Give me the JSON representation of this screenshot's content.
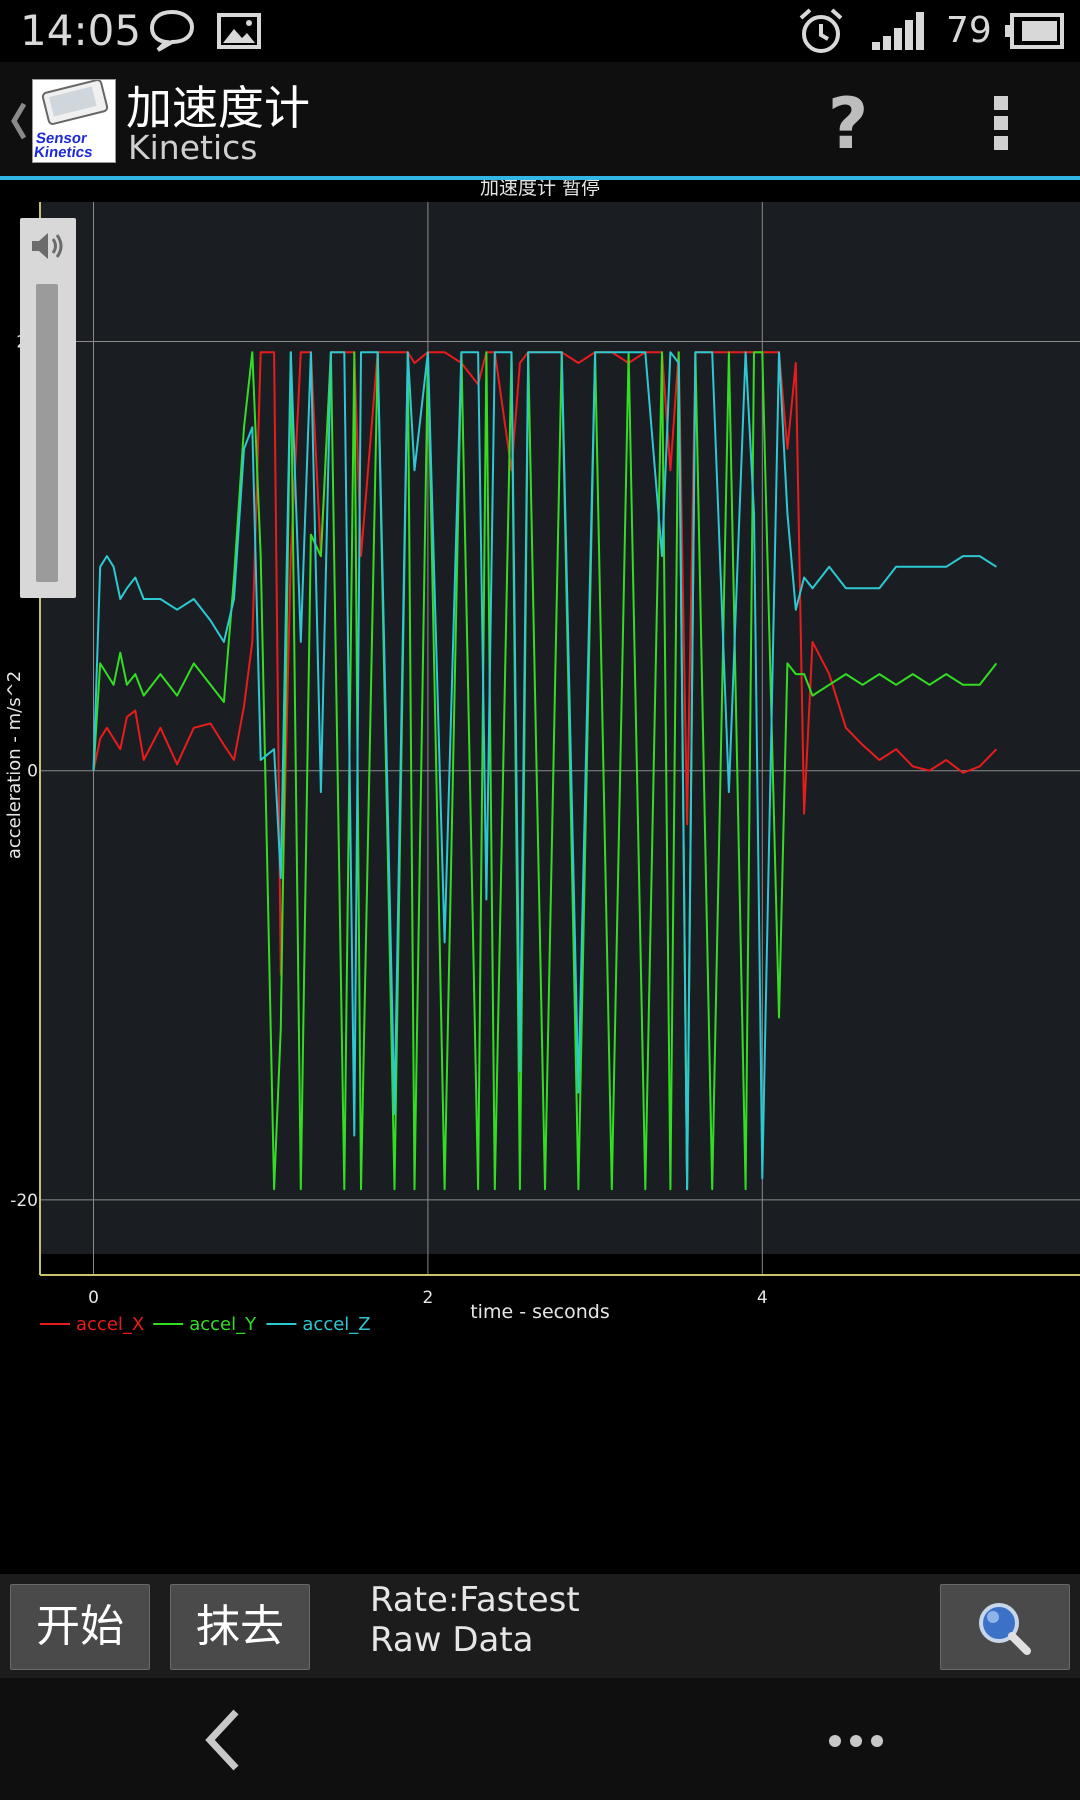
{
  "status_bar": {
    "time": "14:05",
    "battery_level": "79",
    "icons": [
      "chat-icon",
      "image-icon",
      "alarm-icon",
      "signal-icon",
      "battery-icon"
    ]
  },
  "action_bar": {
    "title": "加速度计",
    "subtitle": "Kinetics",
    "app_icon_text": "Sensor Kinetics",
    "help_label": "?",
    "accent_color": "#33b5e5"
  },
  "chart_data": {
    "type": "line",
    "title": "加速度计 暂停",
    "xlabel": "time - seconds",
    "ylabel": "acceleration - m/s^2",
    "xlim": [
      -0.32,
      5.9
    ],
    "ylim": [
      -23.5,
      26.5
    ],
    "x_ticks": [
      0,
      2,
      4
    ],
    "y_ticks": [
      -20,
      0,
      20
    ],
    "grid": true,
    "legend_position": "bottom-left",
    "series": [
      {
        "name": "accel_X",
        "color": "#e81c1c",
        "x": [
          0,
          0.04,
          0.08,
          0.12,
          0.16,
          0.2,
          0.25,
          0.3,
          0.4,
          0.5,
          0.6,
          0.7,
          0.78,
          0.84,
          0.9,
          0.95,
          1.0,
          1.08,
          1.12,
          1.18,
          1.24,
          1.3,
          1.36,
          1.42,
          1.5,
          1.56,
          1.6,
          1.7,
          1.8,
          1.88,
          1.92,
          2.0,
          2.1,
          2.2,
          2.3,
          2.35,
          2.4,
          2.5,
          2.55,
          2.6,
          2.7,
          2.8,
          2.9,
          3.0,
          3.1,
          3.2,
          3.3,
          3.4,
          3.45,
          3.5,
          3.55,
          3.6,
          3.7,
          3.8,
          3.9,
          3.95,
          4.0,
          4.1,
          4.15,
          4.2,
          4.25,
          4.3,
          4.4,
          4.5,
          4.6,
          4.7,
          4.8,
          4.9,
          5.0,
          5.1,
          5.2,
          5.3,
          5.4
        ],
        "y": [
          0,
          1.5,
          2,
          1.5,
          1,
          2.5,
          2.8,
          0.5,
          2,
          0.3,
          2,
          2.2,
          1.2,
          0.5,
          3,
          6,
          19.5,
          19.5,
          -9.5,
          10,
          19.5,
          19.5,
          10,
          19.5,
          19.5,
          19.5,
          10,
          19.5,
          19.5,
          19.5,
          19,
          19.5,
          19.5,
          19,
          18,
          19.5,
          19.5,
          14,
          19,
          19.5,
          19.5,
          19.5,
          19,
          19.5,
          19.5,
          19,
          19.5,
          19.5,
          14,
          19.5,
          -2.5,
          19.5,
          19.5,
          19.5,
          19.5,
          19.5,
          19.5,
          19.5,
          15,
          19,
          -2,
          6,
          4.5,
          2,
          1.2,
          0.5,
          1,
          0.2,
          0,
          0.5,
          -0.1,
          0.2,
          1
        ]
      },
      {
        "name": "accel_Y",
        "color": "#33dd22",
        "x": [
          0,
          0.04,
          0.08,
          0.12,
          0.16,
          0.2,
          0.25,
          0.3,
          0.4,
          0.5,
          0.6,
          0.7,
          0.78,
          0.84,
          0.9,
          0.95,
          1.0,
          1.08,
          1.12,
          1.18,
          1.24,
          1.3,
          1.36,
          1.42,
          1.5,
          1.56,
          1.6,
          1.7,
          1.8,
          1.88,
          1.92,
          2.0,
          2.1,
          2.2,
          2.3,
          2.35,
          2.4,
          2.5,
          2.55,
          2.6,
          2.7,
          2.8,
          2.9,
          3.0,
          3.1,
          3.2,
          3.3,
          3.4,
          3.45,
          3.5,
          3.55,
          3.6,
          3.7,
          3.8,
          3.9,
          3.95,
          4.0,
          4.1,
          4.15,
          4.2,
          4.25,
          4.3,
          4.4,
          4.5,
          4.6,
          4.7,
          4.8,
          4.9,
          5.0,
          5.1,
          5.2,
          5.3,
          5.4
        ],
        "y": [
          0,
          5,
          4.5,
          4,
          5.5,
          4,
          4.5,
          3.5,
          4.5,
          3.5,
          5,
          4,
          3.2,
          9,
          16,
          19.5,
          10,
          -19.5,
          -12,
          19.5,
          -19.5,
          11,
          10,
          19.5,
          -19.5,
          19.5,
          -19.5,
          19.5,
          -19.5,
          19.5,
          -19.5,
          19.5,
          -19.5,
          19.5,
          -19.5,
          19.5,
          -19.5,
          19.5,
          -19.5,
          19.5,
          -19.5,
          19.5,
          -19.5,
          19.5,
          -19.5,
          19.5,
          -19.5,
          19.5,
          -19.5,
          19.5,
          -19.5,
          19.5,
          -19.5,
          19.5,
          -19.5,
          19.5,
          19.5,
          -11.5,
          5,
          4.5,
          4.5,
          3.5,
          4,
          4.5,
          4,
          4.5,
          4,
          4.5,
          4,
          4.5,
          4,
          4,
          5
        ]
      },
      {
        "name": "accel_Z",
        "color": "#2dc8d2",
        "x": [
          0,
          0.04,
          0.08,
          0.12,
          0.16,
          0.2,
          0.25,
          0.3,
          0.4,
          0.5,
          0.6,
          0.7,
          0.78,
          0.84,
          0.9,
          0.95,
          1.0,
          1.08,
          1.12,
          1.18,
          1.24,
          1.3,
          1.36,
          1.42,
          1.5,
          1.56,
          1.6,
          1.7,
          1.8,
          1.88,
          1.92,
          2.0,
          2.1,
          2.2,
          2.3,
          2.35,
          2.4,
          2.5,
          2.55,
          2.6,
          2.7,
          2.8,
          2.9,
          3.0,
          3.1,
          3.2,
          3.3,
          3.4,
          3.45,
          3.5,
          3.55,
          3.6,
          3.7,
          3.8,
          3.9,
          3.95,
          4.0,
          4.1,
          4.15,
          4.2,
          4.25,
          4.3,
          4.4,
          4.5,
          4.6,
          4.7,
          4.8,
          4.9,
          5.0,
          5.1,
          5.2,
          5.3,
          5.4
        ],
        "y": [
          0,
          9.5,
          10,
          9.5,
          8,
          8.5,
          9,
          8,
          8,
          7.5,
          8,
          7,
          6,
          8,
          15,
          16,
          0.5,
          1,
          -5,
          19.5,
          6,
          19.5,
          -1,
          19.5,
          19.5,
          -17,
          19.5,
          19.5,
          -16,
          19.5,
          14,
          19.5,
          -8,
          19.5,
          19.5,
          -6,
          19.5,
          19.5,
          -14,
          19.5,
          19.5,
          19.5,
          -15,
          19.5,
          19.5,
          19.5,
          19.5,
          10,
          19.5,
          19,
          -19.5,
          19.5,
          19.5,
          -1,
          19.5,
          12,
          -19,
          19.5,
          12,
          7.5,
          9,
          8.5,
          9.5,
          8.5,
          8.5,
          8.5,
          9.5,
          9.5,
          9.5,
          9.5,
          10,
          10,
          9.5
        ]
      }
    ]
  },
  "toolbar": {
    "start_label": "开始",
    "erase_label": "抹去",
    "rate_text": "Rate:Fastest",
    "mode_text": "Raw Data"
  }
}
